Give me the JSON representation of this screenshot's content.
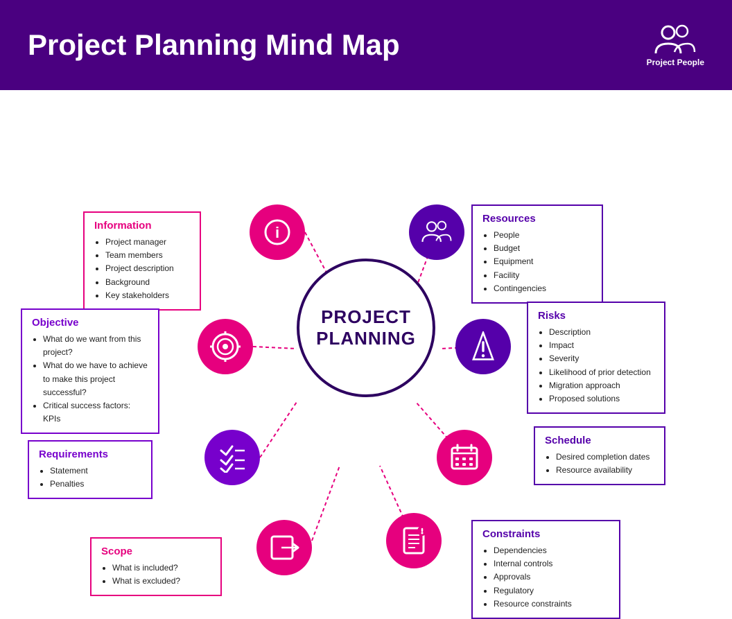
{
  "header": {
    "title": "Project Planning Mind Map",
    "icon_label": "Project People"
  },
  "center": {
    "line1": "PROJECT",
    "line2": "PLANNING"
  },
  "boxes": {
    "information": {
      "title": "Information",
      "items": [
        "Project manager",
        "Team members",
        "Project description",
        "Background",
        "Key stakeholders"
      ]
    },
    "resources": {
      "title": "Resources",
      "items": [
        "People",
        "Budget",
        "Equipment",
        "Facility",
        "Contingencies"
      ]
    },
    "objective": {
      "title": "Objective",
      "items": [
        "What do we want from this project?",
        "What do we have to achieve to make this project successful?",
        "Critical success factors: KPIs"
      ]
    },
    "risks": {
      "title": "Risks",
      "items": [
        "Description",
        "Impact",
        "Severity",
        "Likelihood of prior detection",
        "Migration approach",
        "Proposed solutions"
      ]
    },
    "requirements": {
      "title": "Requirements",
      "items": [
        "Statement",
        "Penalties"
      ]
    },
    "schedule": {
      "title": "Schedule",
      "items": [
        "Desired completion dates",
        "Resource availability"
      ]
    },
    "scope": {
      "title": "Scope",
      "items": [
        "What is included?",
        "What is excluded?"
      ]
    },
    "constraints": {
      "title": "Constraints",
      "items": [
        "Dependencies",
        "Internal controls",
        "Approvals",
        "Regulatory",
        "Resource constraints"
      ]
    }
  }
}
